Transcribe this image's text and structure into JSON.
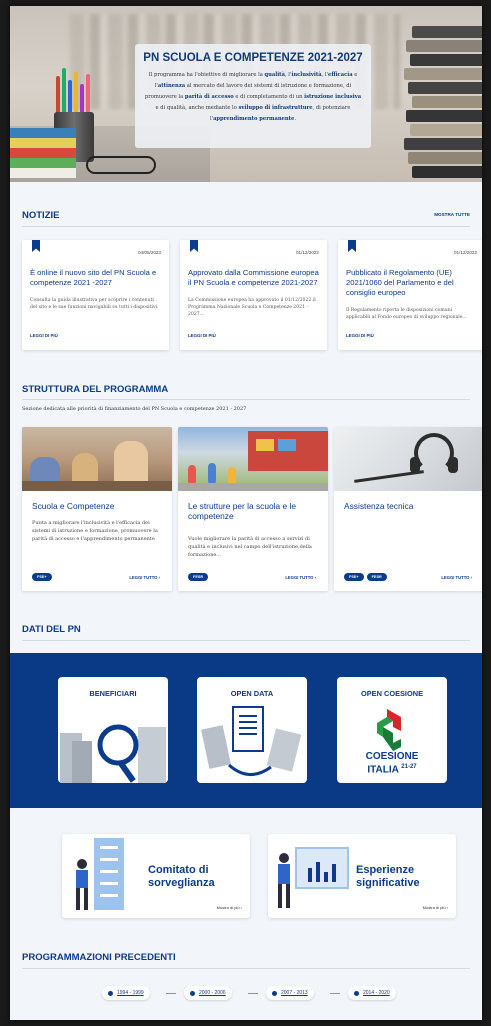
{
  "hero": {
    "title": "PN SCUOLA E COMPETENZE 2021-2027",
    "t1": "Il programma ha l'obiettivo di migliorare la ",
    "b1": "qualità",
    "t2": ", l'",
    "b2": "inclusività",
    "t3": ", l'",
    "b3": "efficacia",
    "t4": " e l'",
    "b4": "attinenza",
    "t5": " al mercato del lavoro dei sistemi di istruzione e formazione, di promuovere la ",
    "b5": "parità di accesso",
    "t6": " e di completamento di un ",
    "b6": "istruzione inclusiva",
    "t7": " e di qualità, anche mediante lo ",
    "b7": "sviluppo di infrastrutture",
    "t8": ", di potenziare l'",
    "b8": "apprendimento permanente",
    "t9": "."
  },
  "news": {
    "heading": "NOTIZIE",
    "show_all": "MOSTRA TUTTE",
    "items": [
      {
        "date": "04/05/2023",
        "title": "È online il nuovo sito del PN Scuola e competenze 2021 -2027",
        "text": "Consulta la guida illustrativa per scoprire i contenuti del sito e le sue funzioni navigabili su tutti i dispositivi.",
        "link": "LEGGI DI PIÙ"
      },
      {
        "date": "01/12/2022",
        "title": "Approvato dalla Commissione europea il PN Scuola e competenze 2021-2027",
        "text": "La Commissione europea ha approvato il 01/12/2022 il Programma Nazionale Scuola e Competenze 2021 - 2027...",
        "link": "LEGGI DI PIÙ"
      },
      {
        "date": "01/12/2022",
        "title": "Pubblicato il Regolamento (UE) 2021/1060 del Parlamento e del consiglio europeo",
        "text": "Il Regolamento riporta le disposizioni comuni applicabili al Fondo europeo di sviluppo regionale...",
        "link": "LEGGI DI PIÙ"
      }
    ]
  },
  "program": {
    "heading": "STRUTTURA  DEL PROGRAMMA",
    "subtitle": "Sezione dedicata alle priorità di finanziamento del PN Scuola e competenze 2021 - 2027",
    "items": [
      {
        "title": "Scuola e Competenze",
        "text": "Punta a migliorare l'inclusività e l'efficacia dei sistemi di istruzione e formazione, promuovere la parità di accesso e l'apprendimento permanente",
        "tags": [
          "FSE+"
        ],
        "more": "LEGGI TUTTO"
      },
      {
        "title": "Le strutture per la scuola e le competenze",
        "text": "Vuole migliorare la parità di accesso a servizi di qualità e inclusivi nel campo dell'istruzione,della formazione...",
        "tags": [
          "FESR"
        ],
        "more": "LEGGI TUTTO"
      },
      {
        "title": "Assistenza tecnica",
        "text": "",
        "tags": [
          "FSE+",
          "FESR"
        ],
        "more": "LEGGI TUTTO"
      }
    ]
  },
  "dati": {
    "heading": "DATI DEL PN",
    "items": [
      {
        "label": "BENEFICIARI",
        "icon": "magnifier-icon"
      },
      {
        "label": "OPEN DATA",
        "icon": "documents-icon"
      },
      {
        "label": "OPEN COESIONE",
        "icon": "coesione-logo",
        "logo_line1": "COESIONE",
        "logo_line2": "ITALIA",
        "logo_years": "21-27"
      }
    ]
  },
  "features": [
    {
      "title": "Comitato di sorveglianza",
      "more": "Mostra di più"
    },
    {
      "title": "Esperienze significative",
      "more": "Mostra di più"
    }
  ],
  "previous": {
    "heading": "PROGRAMMAZIONI PRECEDENTI",
    "items": [
      "1994 - 1999",
      "2000 - 2006",
      "2007 - 2013",
      "2014 - 2020"
    ]
  },
  "colors": {
    "primary": "#0b3b8a",
    "band": "#0a3a86",
    "background": "#f2f5f9"
  }
}
